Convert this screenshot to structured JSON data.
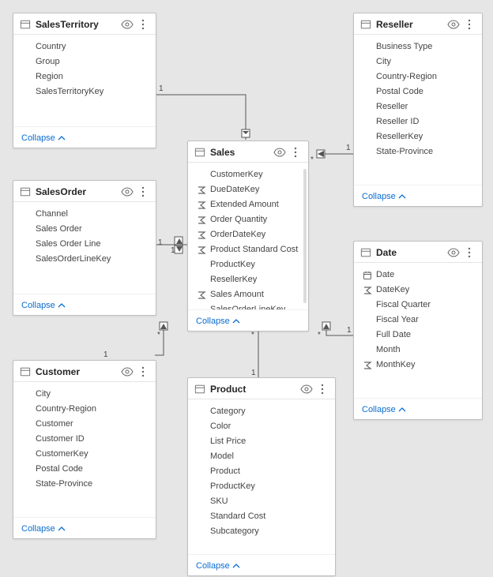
{
  "collapse_label": "Collapse",
  "tables": {
    "salesTerritory": {
      "title": "SalesTerritory",
      "fields": [
        "Country",
        "Group",
        "Region",
        "SalesTerritoryKey"
      ]
    },
    "reseller": {
      "title": "Reseller",
      "fields": [
        "Business Type",
        "City",
        "Country-Region",
        "Postal Code",
        "Reseller",
        "Reseller ID",
        "ResellerKey",
        "State-Province"
      ]
    },
    "salesOrder": {
      "title": "SalesOrder",
      "fields": [
        "Channel",
        "Sales Order",
        "Sales Order Line",
        "SalesOrderLineKey"
      ]
    },
    "sales": {
      "title": "Sales",
      "fields": [
        {
          "label": "CustomerKey",
          "icon": null
        },
        {
          "label": "DueDateKey",
          "icon": "sigma"
        },
        {
          "label": "Extended Amount",
          "icon": "sigma"
        },
        {
          "label": "Order Quantity",
          "icon": "sigma"
        },
        {
          "label": "OrderDateKey",
          "icon": "sigma"
        },
        {
          "label": "Product Standard Cost",
          "icon": "sigma"
        },
        {
          "label": "ProductKey",
          "icon": null
        },
        {
          "label": "ResellerKey",
          "icon": null
        },
        {
          "label": "Sales Amount",
          "icon": "sigma"
        },
        {
          "label": "SalesOrderLineKey",
          "icon": null
        }
      ]
    },
    "date": {
      "title": "Date",
      "fields": [
        {
          "label": "Date",
          "icon": "calendar"
        },
        {
          "label": "DateKey",
          "icon": "sigma"
        },
        {
          "label": "Fiscal Quarter",
          "icon": null
        },
        {
          "label": "Fiscal Year",
          "icon": null
        },
        {
          "label": "Full Date",
          "icon": null
        },
        {
          "label": "Month",
          "icon": null
        },
        {
          "label": "MonthKey",
          "icon": "sigma"
        }
      ]
    },
    "customer": {
      "title": "Customer",
      "fields": [
        "City",
        "Country-Region",
        "Customer",
        "Customer ID",
        "CustomerKey",
        "Postal Code",
        "State-Province"
      ]
    },
    "product": {
      "title": "Product",
      "fields": [
        "Category",
        "Color",
        "List Price",
        "Model",
        "Product",
        "ProductKey",
        "SKU",
        "Standard Cost",
        "Subcategory"
      ]
    }
  },
  "relationships": [
    {
      "from": "SalesTerritory",
      "to": "Sales",
      "from_card": "1",
      "to_card": "*"
    },
    {
      "from": "Reseller",
      "to": "Sales",
      "from_card": "1",
      "to_card": "*"
    },
    {
      "from": "SalesOrder",
      "to": "Sales",
      "from_card": "1",
      "to_card": "1"
    },
    {
      "from": "Customer",
      "to": "Sales",
      "from_card": "1",
      "to_card": "*"
    },
    {
      "from": "Product",
      "to": "Sales",
      "from_card": "1",
      "to_card": "*"
    },
    {
      "from": "Date",
      "to": "Sales",
      "from_card": "1",
      "to_card": "*"
    }
  ]
}
